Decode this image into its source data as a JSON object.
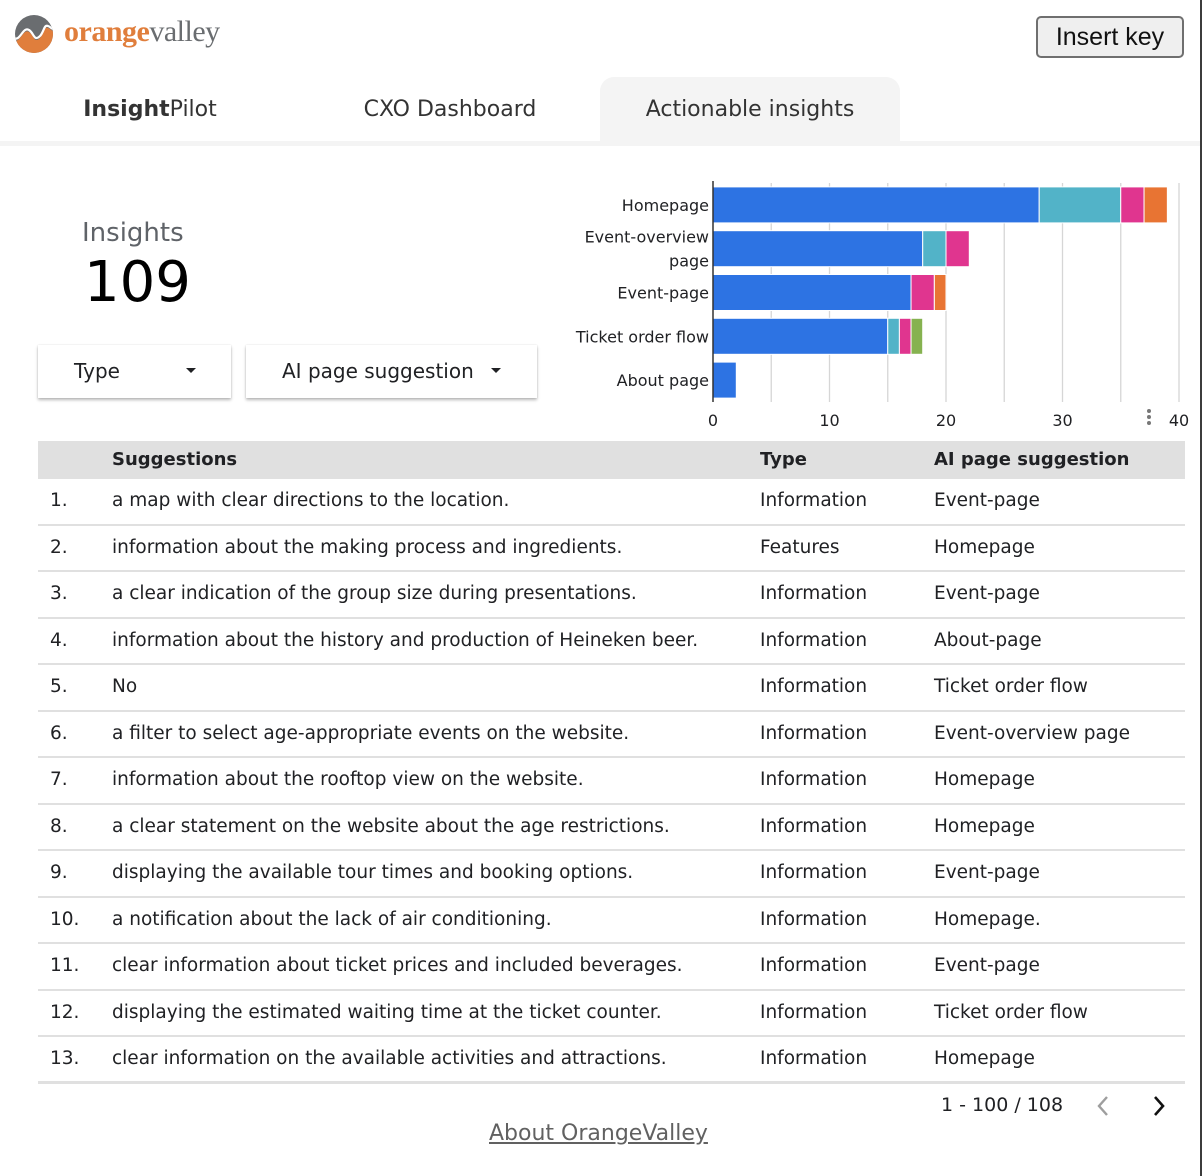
{
  "brand": {
    "logo_orange": "orange",
    "logo_grey": "valley",
    "colors": {
      "orange": "#e07e3c",
      "grey": "#6a6d70"
    }
  },
  "header": {
    "insert_key_label": "Insert key"
  },
  "tabs": [
    {
      "label_bold": "Insight",
      "label_rest": "Pilot",
      "active": false
    },
    {
      "label": "CXO Dashboard",
      "active": false
    },
    {
      "label": "Actionable insights",
      "active": true
    }
  ],
  "scorecard": {
    "label": "Insights",
    "value": "109"
  },
  "filters": [
    {
      "label": "Type",
      "icon": "caret-down-icon"
    },
    {
      "label": "AI page suggestion",
      "icon": "caret-down-icon"
    }
  ],
  "chart_data": {
    "type": "bar",
    "orientation": "horizontal",
    "stacked": true,
    "categories": [
      "Homepage",
      "Event-overview page",
      "Event-page",
      "Ticket order flow",
      "About page"
    ],
    "category_display": [
      [
        "Homepage"
      ],
      [
        "Event-overview",
        "page"
      ],
      [
        "Event-page"
      ],
      [
        "Ticket order flow"
      ],
      [
        "About page"
      ]
    ],
    "series": [
      {
        "name": "series-1",
        "color": "#2d73e3",
        "values": [
          28,
          18,
          17,
          15,
          2
        ]
      },
      {
        "name": "series-2",
        "color": "#52b3c8",
        "values": [
          7,
          2,
          0,
          1,
          0
        ]
      },
      {
        "name": "series-3",
        "color": "#e0358f",
        "values": [
          2,
          2,
          2,
          1,
          0
        ]
      },
      {
        "name": "series-4",
        "color": "#e87433",
        "values": [
          2,
          0,
          1,
          0,
          0
        ]
      },
      {
        "name": "series-5",
        "color": "#86b250",
        "values": [
          0,
          0,
          0,
          1,
          0
        ]
      }
    ],
    "xlim": [
      0,
      40
    ],
    "x_ticks": [
      0,
      10,
      20,
      30,
      40
    ],
    "gridlines_every": 5,
    "grid": true,
    "legend": "none",
    "title": "",
    "xlabel": "",
    "ylabel": ""
  },
  "table": {
    "headers": {
      "index": "",
      "suggestion": "Suggestions",
      "type": "Type",
      "page": "AI page suggestion"
    },
    "rows": [
      {
        "index": "1.",
        "suggestion": "a map with clear directions to the location.",
        "type": "Information",
        "page": "Event-page"
      },
      {
        "index": "2.",
        "suggestion": "information about the making process and ingredients.",
        "type": "Features",
        "page": "Homepage"
      },
      {
        "index": "3.",
        "suggestion": "a clear indication of the group size during presentations.",
        "type": "Information",
        "page": "Event-page"
      },
      {
        "index": "4.",
        "suggestion": "information about the history and production of Heineken beer.",
        "type": "Information",
        "page": "About-page"
      },
      {
        "index": "5.",
        "suggestion": "No",
        "type": "Information",
        "page": "Ticket order flow"
      },
      {
        "index": "6.",
        "suggestion": "a filter to select age-appropriate events on the website.",
        "type": "Information",
        "page": "Event-overview page"
      },
      {
        "index": "7.",
        "suggestion": "information about the rooftop view on the website.",
        "type": "Information",
        "page": "Homepage"
      },
      {
        "index": "8.",
        "suggestion": "a clear statement on the website about the age restrictions.",
        "type": "Information",
        "page": "Homepage"
      },
      {
        "index": "9.",
        "suggestion": "displaying the available tour times and booking options.",
        "type": "Information",
        "page": "Event-page"
      },
      {
        "index": "10.",
        "suggestion": "a notification about the lack of air conditioning.",
        "type": "Information",
        "page": "Homepage."
      },
      {
        "index": "11.",
        "suggestion": "clear information about ticket prices and included beverages.",
        "type": "Information",
        "page": "Event-page"
      },
      {
        "index": "12.",
        "suggestion": "displaying the estimated waiting time at the ticket counter.",
        "type": "Information",
        "page": "Ticket order flow"
      },
      {
        "index": "13.",
        "suggestion": "clear information on the available activities and attractions.",
        "type": "Information",
        "page": "Homepage"
      }
    ]
  },
  "pagination": {
    "range_text": "1 - 100 / 108",
    "prev_enabled": false,
    "next_enabled": true
  },
  "footer": {
    "link_label": "About OrangeValley"
  }
}
